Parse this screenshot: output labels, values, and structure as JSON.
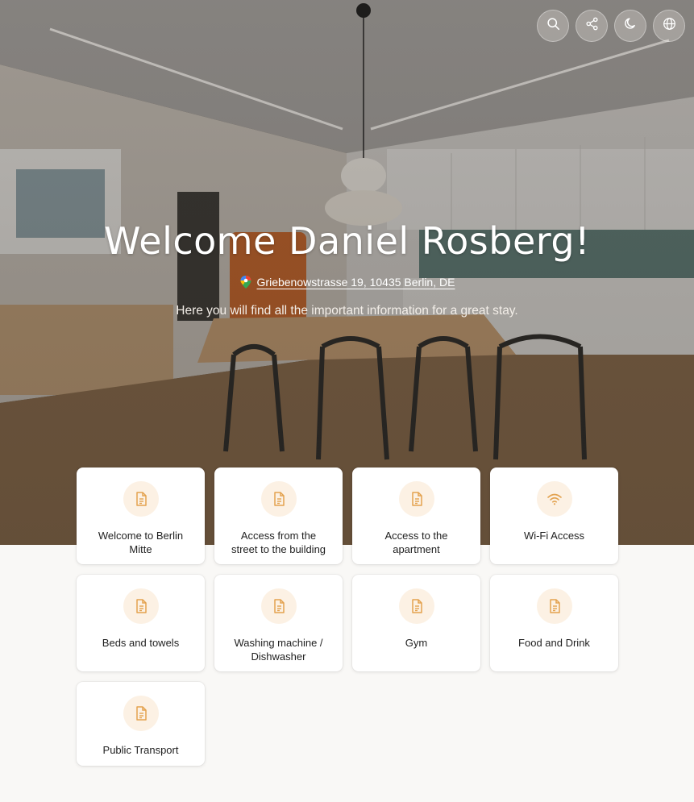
{
  "hero": {
    "title": "Welcome Daniel Rosberg!",
    "address": "Griebenowstrasse 19, 10435 Berlin, DE",
    "subtitle": "Here you will find all the important information for a great stay."
  },
  "top_actions": [
    {
      "name": "search-button",
      "icon": "search-icon"
    },
    {
      "name": "share-button",
      "icon": "share-icon"
    },
    {
      "name": "dark-mode-button",
      "icon": "moon-icon"
    },
    {
      "name": "language-button",
      "icon": "globe-icon"
    }
  ],
  "colors": {
    "accent": "#e3a24f",
    "accent_bg": "#fcf1e4",
    "page_bg": "#f9f8f6",
    "card_bg": "#ffffff"
  },
  "cards": [
    {
      "label": "Welcome to Berlin Mitte",
      "icon": "document-icon"
    },
    {
      "label": "Access from the street to the building",
      "icon": "document-icon"
    },
    {
      "label": "Access to the apartment",
      "icon": "document-icon"
    },
    {
      "label": "Wi-Fi Access",
      "icon": "wifi-icon"
    },
    {
      "label": "Beds and towels",
      "icon": "document-icon"
    },
    {
      "label": "Washing machine / Dishwasher",
      "icon": "document-icon"
    },
    {
      "label": "Gym",
      "icon": "document-icon"
    },
    {
      "label": "Food and Drink",
      "icon": "document-icon"
    },
    {
      "label": "Public Transport",
      "icon": "document-icon"
    }
  ]
}
